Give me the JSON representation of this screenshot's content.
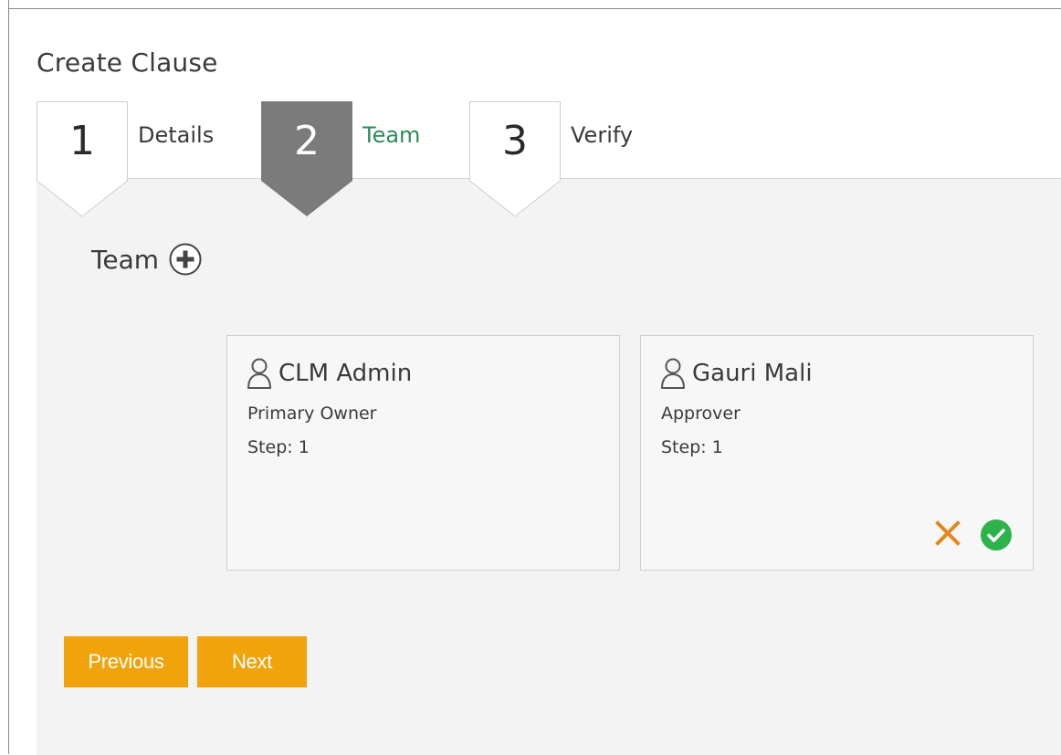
{
  "page": {
    "title": "Create Clause"
  },
  "steps": [
    {
      "number": "1",
      "label": "Details",
      "active": false
    },
    {
      "number": "2",
      "label": "Team",
      "active": true
    },
    {
      "number": "3",
      "label": "Verify",
      "active": false
    }
  ],
  "team_section": {
    "label": "Team",
    "add_icon": "plus-circle-icon"
  },
  "members": [
    {
      "name": "CLM Admin",
      "role": "Primary Owner",
      "step": "Step: 1",
      "icon": "user-icon"
    },
    {
      "name": "Gauri Mali",
      "role": "Approver",
      "step": "Step: 1",
      "icon": "user-icon",
      "actions": [
        "reject-icon",
        "approve-icon"
      ]
    }
  ],
  "buttons": {
    "previous": "Previous",
    "next": "Next"
  },
  "colors": {
    "accent": "#f0a30a",
    "active_step": "#7b7b7b",
    "active_label": "#2e8b57",
    "approve": "#2db34a",
    "reject": "#e08a1e",
    "panel": "#f3f3f3"
  }
}
